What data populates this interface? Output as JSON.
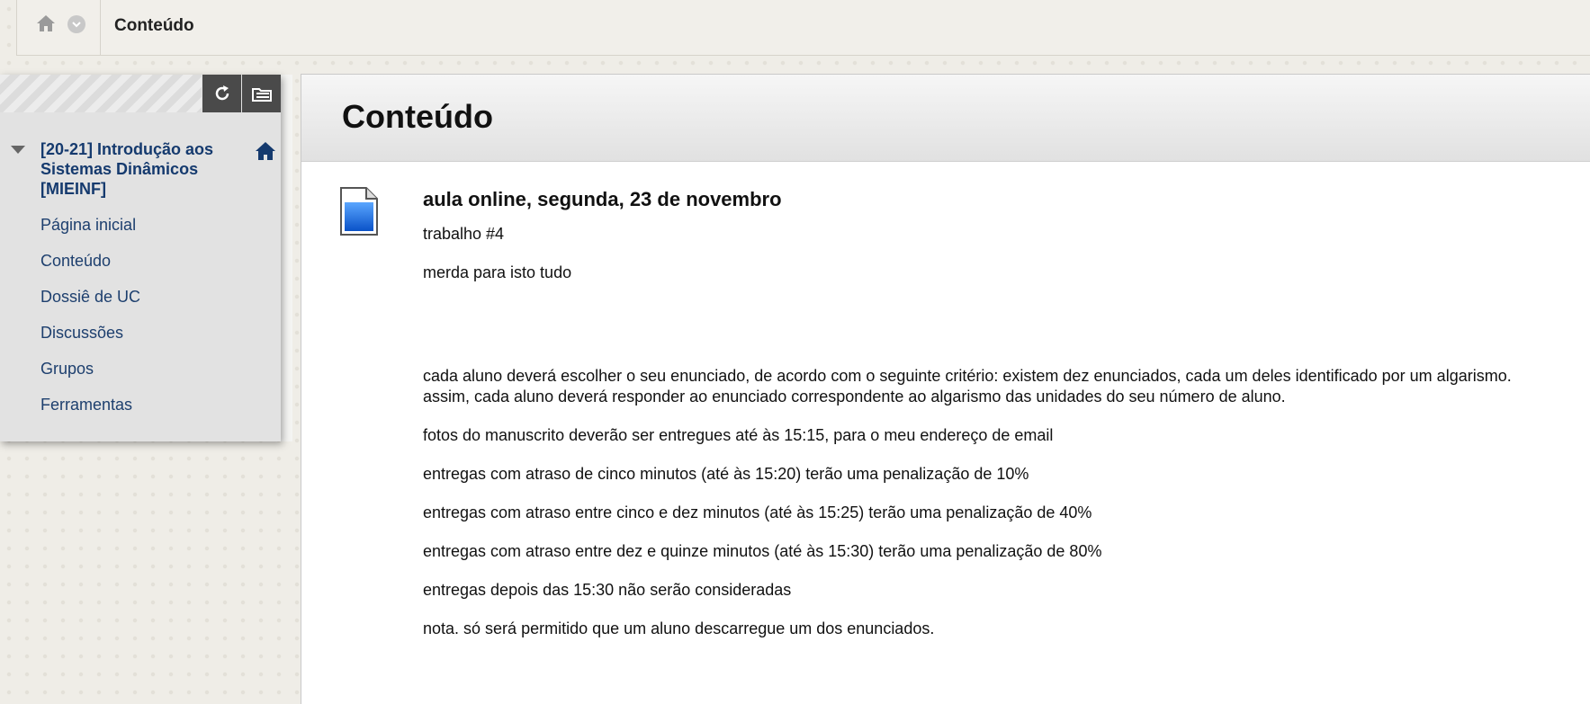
{
  "breadcrumb": {
    "title": "Conteúdo"
  },
  "sidebar": {
    "course_title": "[20-21] Introdução aos Sistemas Dinâmicos [MIEINF]",
    "items": [
      {
        "label": "Página inicial"
      },
      {
        "label": "Conteúdo"
      },
      {
        "label": "Dossiê de UC"
      },
      {
        "label": "Discussões"
      },
      {
        "label": "Grupos"
      },
      {
        "label": "Ferramentas"
      }
    ]
  },
  "main": {
    "title": "Conteúdo",
    "item": {
      "title": "aula online, segunda, 23 de novembro",
      "paragraphs": [
        "trabalho #4",
        "merda para isto tudo",
        "cada aluno deverá escolher o seu enunciado, de acordo com o seguinte critério: existem dez enunciados, cada um deles identificado por um algarismo. assim, cada aluno deverá responder ao enunciado correspondente ao algarismo das unidades do seu número de aluno.",
        "fotos do manuscrito deverão ser entregues até às 15:15, para o meu endereço de email",
        "entregas com atraso de cinco minutos (até às 15:20) terão uma penalização de 10%",
        "entregas com atraso entre cinco e dez minutos (até às 15:25) terão uma penalização de 40%",
        "entregas com atraso entre dez e quinze minutos (até às 15:30) terão uma penalização de 80%",
        "entregas depois das 15:30 não serão consideradas",
        "nota. só será permitido que um aluno descarregue um dos enunciados."
      ]
    }
  },
  "colors": {
    "link": "#1d3f6e",
    "course_title": "#153a6e",
    "toolbar_button": "#4a4a4a"
  }
}
